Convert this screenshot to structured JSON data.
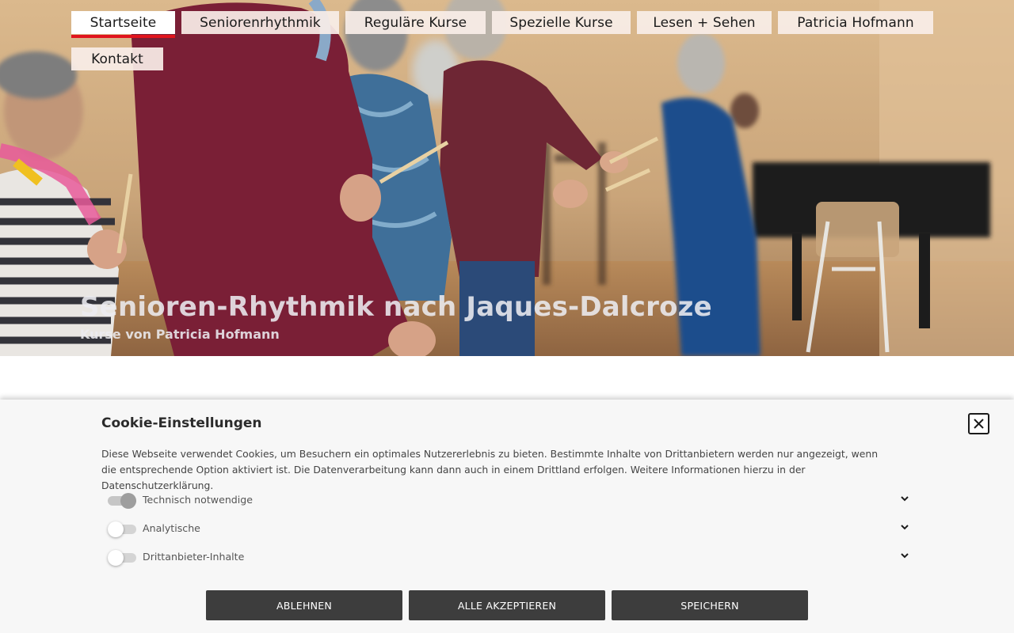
{
  "nav": {
    "items": [
      {
        "label": "Startseite",
        "active": true
      },
      {
        "label": "Seniorenrhythmik",
        "active": false
      },
      {
        "label": "Reguläre Kurse",
        "active": false
      },
      {
        "label": "Spezielle Kurse",
        "active": false
      },
      {
        "label": "Lesen + Sehen",
        "active": false
      },
      {
        "label": "Patricia Hofmann",
        "active": false
      },
      {
        "label": "Kontakt",
        "active": false
      }
    ],
    "active_underline_color": "#e0141d"
  },
  "hero": {
    "title": "Senioren-Rhythmik nach Jaques-Dalcroze",
    "subtitle": "Kurse von Patricia Hofmann"
  },
  "cookie": {
    "title": "Cookie-Einstellungen",
    "close_icon": "close-icon",
    "text": "Diese Webseite verwendet Cookies, um Besuchern ein optimales Nutzererlebnis zu bieten. Bestimmte Inhalte von Drittanbietern werden nur angezeigt, wenn die entspre­chende Option aktiviert ist. Die Datenverarbeitung kann dann auch in einem Drittland erfolgen. Weitere Informationen hierzu in der Datenschutzerklärung.",
    "options": [
      {
        "label": "Technisch notwendige",
        "enabled": true
      },
      {
        "label": "Analytische",
        "enabled": false
      },
      {
        "label": "Drittanbieter-Inhalte",
        "enabled": false
      }
    ],
    "buttons": {
      "reject": "ABLEHNEN",
      "accept_all": "ALLE AKZEPTIEREN",
      "save": "SPEICHERN"
    },
    "button_color": "#3d3d3d"
  }
}
